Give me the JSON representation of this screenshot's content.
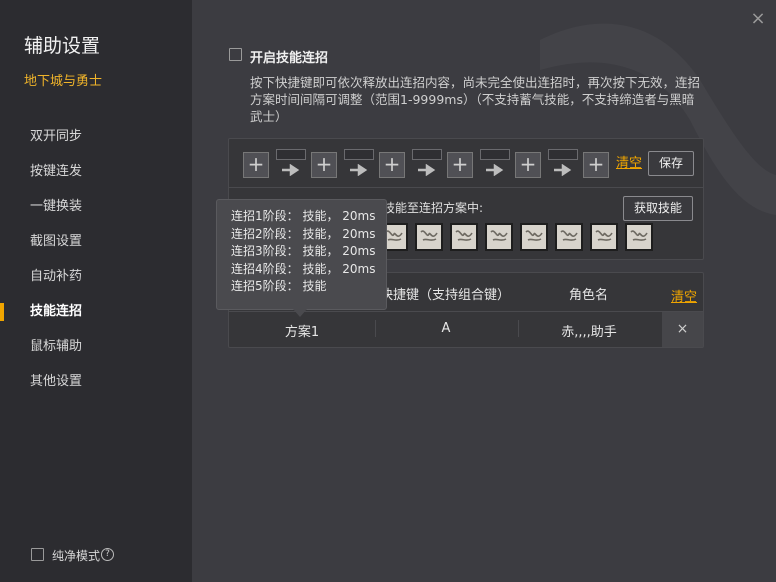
{
  "sidebar": {
    "title": "辅助设置",
    "game": "地下城与勇士",
    "items": [
      {
        "label": "双开同步"
      },
      {
        "label": "按键连发"
      },
      {
        "label": "一键换装"
      },
      {
        "label": "截图设置"
      },
      {
        "label": "自动补药"
      },
      {
        "label": "技能连招"
      },
      {
        "label": "鼠标辅助"
      },
      {
        "label": "其他设置"
      }
    ],
    "active_index": 5,
    "pure_mode_label": "纯净模式",
    "help_glyph": "?"
  },
  "close_glyph": "×",
  "combo": {
    "enable_label": "开启技能连招",
    "description": "按下快捷键即可依次释放出连招内容，尚未完全使出连招时，再次按下无效，连招方案时间间隔可调整（范围1-9999ms）（不支持蓄气技能，不支持缔造者与黑暗武士）",
    "plus_glyph": "+",
    "clear_label": "清空",
    "save_label": "保存",
    "skill_hint": "技能至连招方案中:",
    "fetch_label": "获取技能",
    "skill_icon_count": 8
  },
  "table": {
    "headers": [
      "快捷键（支持组合键）",
      "角色名"
    ],
    "clear_label": "清空",
    "rows": [
      {
        "plan": "方案1",
        "hotkey": "A",
        "role": "赤,,,,助手"
      }
    ],
    "delete_glyph": "×"
  },
  "tooltip": {
    "lines": [
      "连招1阶段：  技能，  20ms",
      "连招2阶段：  技能，  20ms",
      "连招3阶段：  技能，  20ms",
      "连招4阶段：  技能，  20ms",
      "连招5阶段：  技能"
    ]
  },
  "colors": {
    "accent": "#f0a500",
    "game_name": "#f0b42a",
    "sidebar_bg": "#2c2c30",
    "main_bg": "#3c3c41"
  },
  "icons": {
    "close": "close-icon",
    "plus": "plus-icon",
    "arrow": "arrow-right-icon",
    "skill": "skill-icon",
    "help": "question-circle-icon",
    "delete": "close-icon"
  }
}
